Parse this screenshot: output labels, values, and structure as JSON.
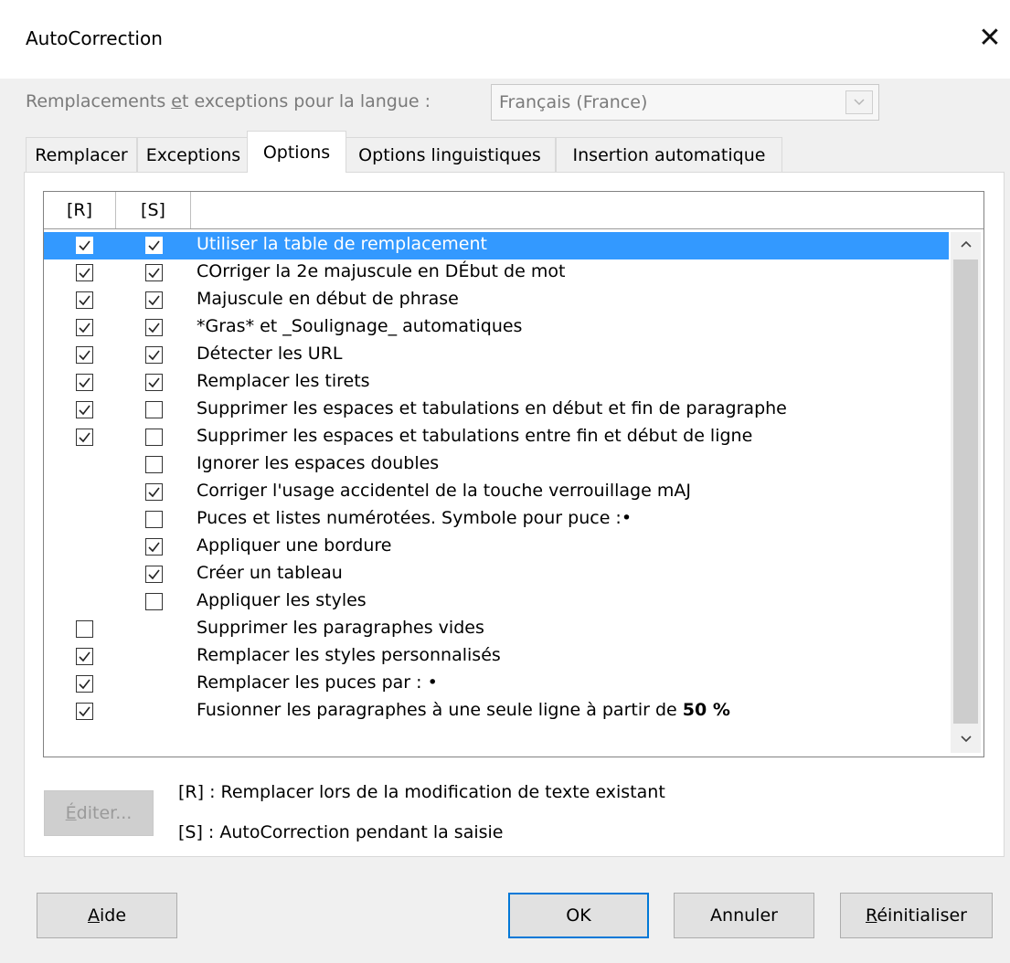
{
  "dialog": {
    "title": "AutoCorrection",
    "close_glyph": "✕"
  },
  "language": {
    "label": "Remplacements et exceptions pour la langue :",
    "value": "Français (France)",
    "dropdown_icon": "chevron-down-icon"
  },
  "tabs": [
    {
      "label": "Remplacer",
      "active": false
    },
    {
      "label": "Exceptions",
      "active": false
    },
    {
      "label": "Options",
      "active": true
    },
    {
      "label": "Options linguistiques",
      "active": false
    },
    {
      "label": "Insertion automatique",
      "active": false
    }
  ],
  "options": {
    "columns": {
      "r": "[R]",
      "s": "[S]",
      "label": ""
    },
    "rows": [
      {
        "label": "Utiliser la table de remplacement",
        "r": true,
        "s": true,
        "selected": true
      },
      {
        "label": "COrriger la 2e majuscule en DÉbut de mot",
        "r": true,
        "s": true
      },
      {
        "label": "Majuscule en début de phrase",
        "r": true,
        "s": true
      },
      {
        "label": "*Gras* et _Soulignage_ automatiques",
        "r": true,
        "s": true
      },
      {
        "label": "Détecter les URL",
        "r": true,
        "s": true
      },
      {
        "label": "Remplacer les tirets",
        "r": true,
        "s": true
      },
      {
        "label": "Supprimer les espaces et tabulations en début et fin de paragraphe",
        "r": true,
        "s": false
      },
      {
        "label": "Supprimer les espaces et tabulations entre fin et début de ligne",
        "r": true,
        "s": false
      },
      {
        "label": "Ignorer les espaces doubles",
        "r": null,
        "s": false
      },
      {
        "label": "Corriger l'usage accidentel de la touche verrouillage mAJ",
        "r": null,
        "s": true
      },
      {
        "label": "Puces et listes numérotées. Symbole pour puce :•",
        "r": null,
        "s": false
      },
      {
        "label": "Appliquer une bordure",
        "r": null,
        "s": true
      },
      {
        "label": "Créer un tableau",
        "r": null,
        "s": true
      },
      {
        "label": "Appliquer les styles",
        "r": null,
        "s": false
      },
      {
        "label": "Supprimer les paragraphes vides",
        "r": false,
        "s": null
      },
      {
        "label": "Remplacer les styles personnalisés",
        "r": true,
        "s": null
      },
      {
        "label": "Remplacer les puces par : •",
        "r": true,
        "s": null
      },
      {
        "label": "Fusionner les paragraphes à une seule ligne à partir de ",
        "bold_suffix": "50 %",
        "r": true,
        "s": null
      }
    ]
  },
  "edit_button": {
    "label": "Éditer..."
  },
  "legend": {
    "r": "[R] : Remplacer lors de la modification de texte existant",
    "s": "[S] : AutoCorrection pendant la saisie"
  },
  "buttons": {
    "help": "Aide",
    "ok": "OK",
    "cancel": "Annuler",
    "reset": "Réinitialiser"
  },
  "colors": {
    "selection": "#3399ff",
    "default_button_border": "#0078d7"
  }
}
